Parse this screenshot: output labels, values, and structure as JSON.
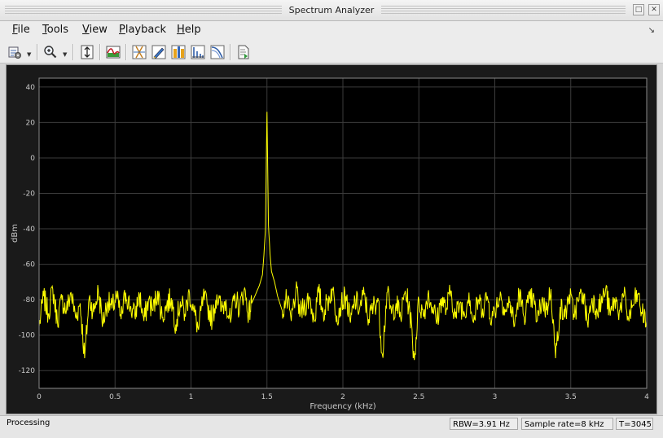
{
  "window": {
    "title": "Spectrum Analyzer"
  },
  "menu": {
    "items": [
      {
        "mn": "F",
        "rest": "ile"
      },
      {
        "mn": "T",
        "rest": "ools"
      },
      {
        "mn": "V",
        "rest": "iew"
      },
      {
        "mn": "P",
        "rest": "layback"
      },
      {
        "mn": "H",
        "rest": "elp"
      }
    ]
  },
  "toolbar": {
    "icons": [
      "spectrum-settings-icon",
      "zoom-in-icon",
      "scale-y-axis-icon",
      "spectrum-display-icon",
      "cursor-measurements-icon",
      "peak-finder-icon",
      "channel-measurements-icon",
      "distortion-measurements-icon",
      "ccdf-measurements-icon",
      "generate-script-icon"
    ]
  },
  "status": {
    "state": "Processing",
    "rbw": "RBW=3.91 Hz",
    "sample_rate": "Sample rate=8 kHz",
    "time": "T=3045"
  },
  "colors": {
    "trace": "#ffff00",
    "axes_bg": "#000000",
    "panel_bg": "#1a1a1a",
    "grid": "#3c3c3c",
    "tick_text": "#c8c8c8"
  },
  "chart_data": {
    "type": "line",
    "xlabel": "Frequency (kHz)",
    "ylabel": "dBm",
    "xlim": [
      0,
      4
    ],
    "ylim": [
      -130,
      45
    ],
    "xticks": [
      0,
      0.5,
      1,
      1.5,
      2,
      2.5,
      3,
      3.5,
      4
    ],
    "xticklabels": [
      "0",
      "0.5",
      "1",
      "1.5",
      "2",
      "2.5",
      "3",
      "3.5",
      "4"
    ],
    "yticks": [
      40,
      20,
      0,
      -20,
      -40,
      -60,
      -80,
      -100,
      -120
    ],
    "yticklabels": [
      "40",
      "20",
      "0",
      "-20",
      "-40",
      "-60",
      "-80",
      "-100",
      "-120"
    ],
    "grid": true,
    "series": [
      {
        "peak": {
          "x": 1.5,
          "y": 26
        },
        "noise_floor": -82,
        "x": [
          0,
          0.03,
          0.06,
          0.09,
          0.12,
          0.15,
          0.18,
          0.21,
          0.24,
          0.27,
          0.3,
          0.33,
          0.36,
          0.39,
          0.42,
          0.45,
          0.48,
          0.51,
          0.54,
          0.57,
          0.6,
          0.63,
          0.66,
          0.69,
          0.72,
          0.75,
          0.78,
          0.81,
          0.84,
          0.87,
          0.9,
          0.93,
          0.96,
          0.99,
          1.02,
          1.05,
          1.08,
          1.11,
          1.14,
          1.17,
          1.2,
          1.23,
          1.26,
          1.29,
          1.32,
          1.35,
          1.38,
          1.4,
          1.43,
          1.45,
          1.47,
          1.48,
          1.49,
          1.5,
          1.51,
          1.52,
          1.53,
          1.55,
          1.57,
          1.6,
          1.63,
          1.66,
          1.69,
          1.72,
          1.75,
          1.78,
          1.81,
          1.84,
          1.87,
          1.9,
          1.93,
          1.96,
          1.99,
          2.02,
          2.05,
          2.08,
          2.11,
          2.14,
          2.17,
          2.2,
          2.23,
          2.26,
          2.29,
          2.32,
          2.35,
          2.38,
          2.41,
          2.44,
          2.47,
          2.5,
          2.53,
          2.56,
          2.59,
          2.62,
          2.65,
          2.68,
          2.71,
          2.74,
          2.77,
          2.8,
          2.83,
          2.86,
          2.89,
          2.92,
          2.95,
          2.98,
          3.01,
          3.04,
          3.07,
          3.1,
          3.13,
          3.16,
          3.19,
          3.22,
          3.25,
          3.28,
          3.31,
          3.34,
          3.37,
          3.4,
          3.43,
          3.46,
          3.49,
          3.52,
          3.55,
          3.58,
          3.61,
          3.64,
          3.67,
          3.7,
          3.73,
          3.76,
          3.79,
          3.82,
          3.85,
          3.88,
          3.91,
          3.94,
          3.97,
          4.0
        ],
        "y": [
          -95,
          -78,
          -88,
          -74,
          -92,
          -80,
          -86,
          -76,
          -90,
          -82,
          -113,
          -79,
          -87,
          -75,
          -93,
          -81,
          -85,
          -78,
          -91,
          -76,
          -84,
          -89,
          -77,
          -92,
          -80,
          -86,
          -75,
          -90,
          -83,
          -79,
          -94,
          -81,
          -88,
          -76,
          -87,
          -97,
          -79,
          -84,
          -91,
          -77,
          -86,
          -80,
          -93,
          -78,
          -85,
          -74,
          -88,
          -82,
          -76,
          -72,
          -66,
          -55,
          -40,
          26,
          -38,
          -54,
          -64,
          -70,
          -78,
          -86,
          -80,
          -92,
          -75,
          -88,
          -83,
          -79,
          -91,
          -76,
          -87,
          -81,
          -74,
          -89,
          -82,
          -78,
          -93,
          -80,
          -85,
          -77,
          -91,
          -84,
          -79,
          -111,
          -76,
          -88,
          -82,
          -90,
          -75,
          -86,
          -114,
          -80,
          -89,
          -77,
          -84,
          -92,
          -79,
          -86,
          -75,
          -90,
          -82,
          -88,
          -76,
          -93,
          -80,
          -85,
          -78,
          -91,
          -83,
          -77,
          -87,
          -81,
          -95,
          -76,
          -89,
          -82,
          -79,
          -92,
          -80,
          -86,
          -74,
          -113,
          -84,
          -90,
          -77,
          -88,
          -81,
          -76,
          -93,
          -79,
          -85,
          -82,
          -74,
          -89,
          -80,
          -86,
          -78,
          -91,
          -83,
          -77,
          -88,
          -92
        ]
      }
    ]
  }
}
